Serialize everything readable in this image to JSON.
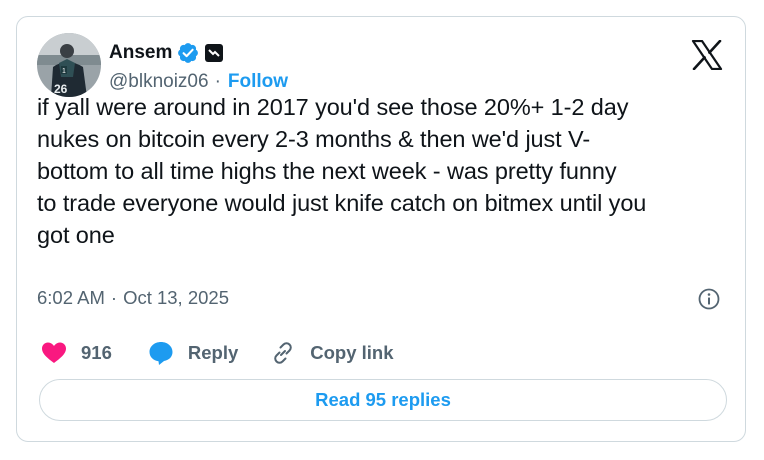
{
  "author": {
    "display_name": "Ansem",
    "handle": "@blknoiz06",
    "follow_label": "Follow",
    "separator": "·",
    "avatar_jersey_number": "26",
    "verified_icon": "verified-badge-icon",
    "affiliate_icon": "affiliate-badge-icon"
  },
  "tweet": {
    "text": "if yall were around in 2017 you'd see those 20%+ 1-2 day nukes on bitcoin every 2-3 months & then we'd just V-bottom to all time highs the next week - was pretty funny to trade everyone would just knife catch on bitmex until you got one",
    "lines": [
      "if yall were around in 2017 you'd see those 20%+ 1-2 day",
      "nukes on bitcoin every 2-3 months & then we'd just V-",
      "bottom to all time highs the next week - was pretty funny",
      "to trade everyone would just knife catch on bitmex until you",
      "got one"
    ],
    "time": "6:02 AM",
    "separator": "·",
    "date": "Oct 13, 2025"
  },
  "actions": {
    "like_count": "916",
    "reply_label": "Reply",
    "copy_link_label": "Copy link"
  },
  "footer": {
    "read_replies_label": "Read 95 replies"
  },
  "colors": {
    "accent": "#1d9bf0",
    "like": "#f91880",
    "text": "#0f1419",
    "muted": "#536471",
    "border": "#cfd9de"
  },
  "icons": [
    "x-logo-icon",
    "info-icon",
    "heart-icon",
    "reply-bubble-icon",
    "link-icon"
  ]
}
